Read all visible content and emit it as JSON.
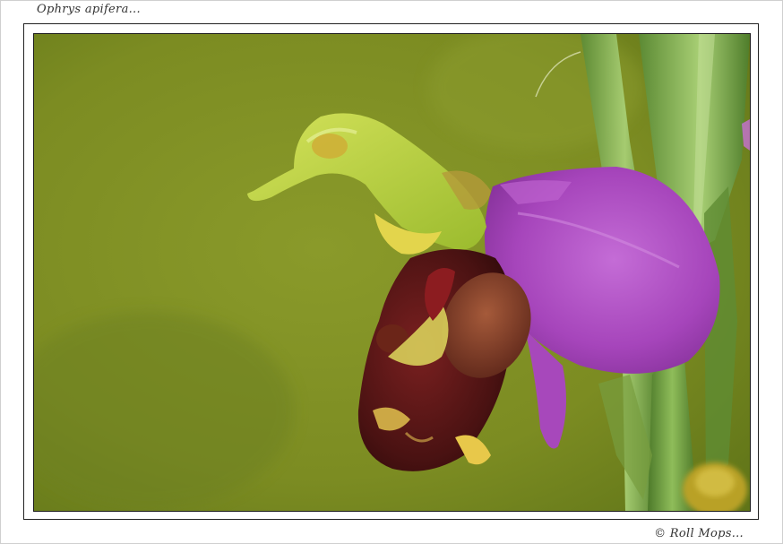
{
  "caption": {
    "title": "Ophrys apifera...",
    "credit": "© Roll Mops..."
  },
  "photo": {
    "subject": "bee-orchid-flower",
    "colors": {
      "background": "#7f8f22",
      "petal": "#b24ec2",
      "lip": "#4a1414",
      "column": "#b7cf3a",
      "stem": "#6e9a3c"
    }
  }
}
